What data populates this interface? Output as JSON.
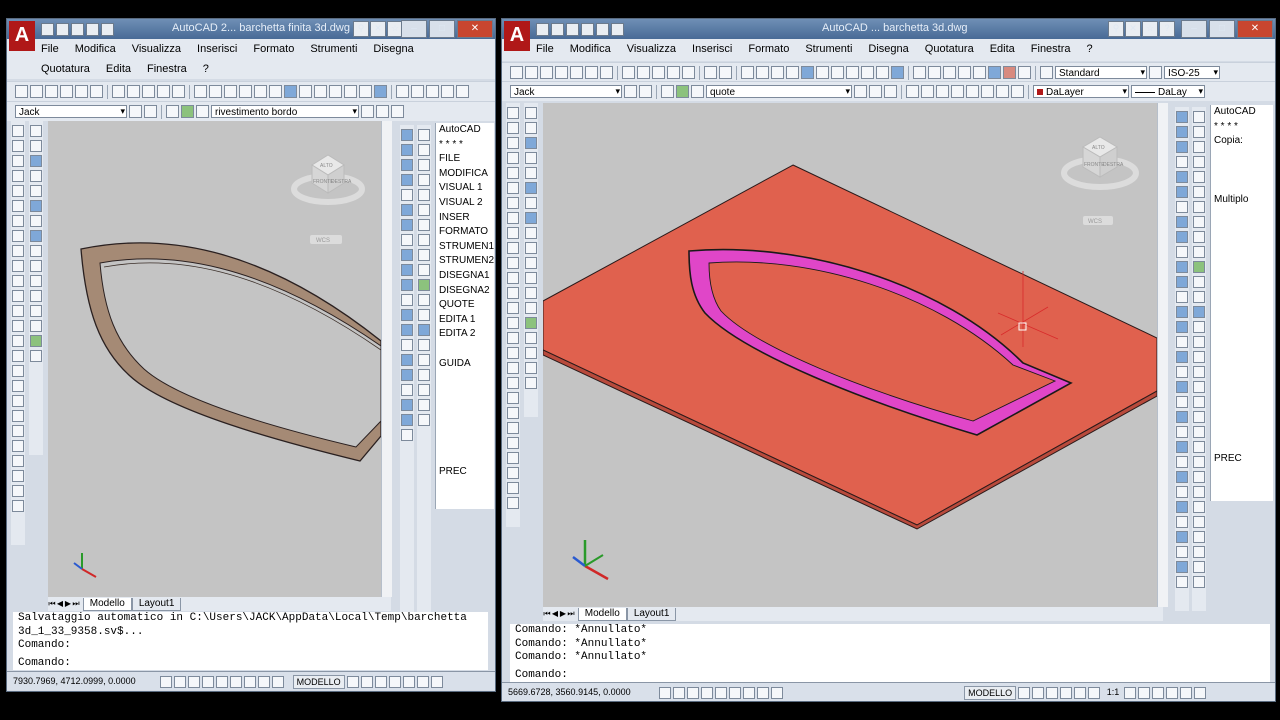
{
  "left": {
    "title": "AutoCAD 2... barchetta finita 3d.dwg",
    "menu": [
      "File",
      "Modifica",
      "Visualizza",
      "Inserisci",
      "Formato",
      "Strumenti",
      "Disegna"
    ],
    "menu2": [
      "Quotatura",
      "Edita",
      "Finestra",
      "?"
    ],
    "style_combo": "Jack",
    "layer_combo": "rivestimento bordo",
    "screen_menu": [
      "AutoCAD",
      "* * * *",
      "FILE",
      "MODIFICA",
      "VISUAL 1",
      "VISUAL 2",
      "INSER",
      "FORMATO",
      "STRUMEN1",
      "STRUMEN2",
      "DISEGNA1",
      "DISEGNA2",
      "QUOTE",
      "EDITA 1",
      "EDITA 2",
      "",
      "GUIDA"
    ],
    "screen_menu_prev": "PREC",
    "viewcube": {
      "top": "ALTO",
      "front": "FRONTE",
      "right": "DESTRA",
      "wcs": "WCS"
    },
    "tabs": [
      "Modello",
      "Layout1"
    ],
    "command_lines": [
      "Salvataggio automatico in C:\\Users\\JACK\\AppData\\Local\\Temp\\barchetta",
      "3d_1_33_9358.sv$...",
      "Comando:",
      "",
      "Comando:"
    ],
    "coords": "7930.7969, 4712.0999, 0.0000",
    "mode_label": "MODELLO",
    "colors": {
      "boat": "#a58a75",
      "viewport": "#c4c4c4"
    }
  },
  "right": {
    "title": "AutoCAD ... barchetta 3d.dwg",
    "menu": [
      "File",
      "Modifica",
      "Visualizza",
      "Inserisci",
      "Formato",
      "Strumenti",
      "Disegna",
      "Quotatura",
      "Edita",
      "Finestra",
      "?"
    ],
    "text_style": "Standard",
    "dim_style": "ISO-25",
    "style_combo": "Jack",
    "layer_combo": "quote",
    "color_combo": "DaLayer",
    "linetype_combo": "DaLay",
    "screen_menu": [
      "AutoCAD",
      "* * * *",
      "Copia:",
      "",
      "",
      "",
      "Multiplo"
    ],
    "screen_menu_prev": "PREC",
    "viewcube": {
      "top": "ALTO",
      "front": "FRONTE",
      "right": "DESTRA",
      "wcs": "WCS"
    },
    "tabs": [
      "Modello",
      "Layout1"
    ],
    "command_lines": [
      "Comando: *Annullato*",
      "Comando: *Annullato*",
      "Comando: *Annullato*",
      "",
      "Comando:"
    ],
    "coords": "5669.6728, 3560.9145, 0.0000",
    "mode_label": "MODELLO",
    "scale_label": "1:1",
    "colors": {
      "plate": "#e0614e",
      "rim": "#e046c8",
      "viewport": "#c4c4c4"
    }
  }
}
